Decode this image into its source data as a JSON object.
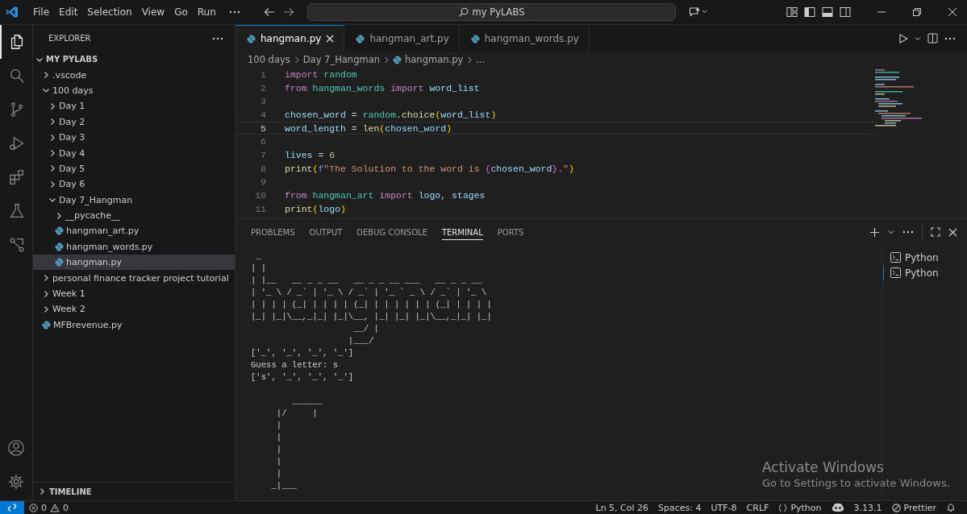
{
  "window": {
    "search": "my PyLABS"
  },
  "menu": [
    "File",
    "Edit",
    "Selection",
    "View",
    "Go",
    "Run"
  ],
  "activity_bar": [
    {
      "selected": true
    },
    {
      "selected": false
    },
    {
      "selected": false
    },
    {
      "selected": false
    },
    {
      "selected": false
    },
    {
      "selected": false
    },
    {
      "selected": false
    }
  ],
  "explorer": {
    "title": "EXPLORER",
    "root": {
      "label": "MY PYLABS",
      "kind": "folder",
      "expanded": true,
      "selected": false,
      "children": [
        {
          "label": ".vscode",
          "kind": "folder",
          "expanded": false,
          "selected": false
        },
        {
          "label": "100 days",
          "kind": "folder",
          "expanded": true,
          "selected": false,
          "children": [
            {
              "label": "Day 1",
              "kind": "folder",
              "expanded": false,
              "selected": false
            },
            {
              "label": "Day 2",
              "kind": "folder",
              "expanded": false,
              "selected": false
            },
            {
              "label": "Day 3",
              "kind": "folder",
              "expanded": false,
              "selected": false
            },
            {
              "label": "Day 4",
              "kind": "folder",
              "expanded": false,
              "selected": false
            },
            {
              "label": "Day 5",
              "kind": "folder",
              "expanded": false,
              "selected": false
            },
            {
              "label": "Day 6",
              "kind": "folder",
              "expanded": false,
              "selected": false
            },
            {
              "label": "Day 7_Hangman",
              "kind": "folder",
              "expanded": true,
              "selected": false,
              "children": [
                {
                  "label": "__pycache__",
                  "kind": "folder",
                  "expanded": false,
                  "selected": false
                },
                {
                  "label": "hangman_art.py",
                  "kind": "file",
                  "selected": false
                },
                {
                  "label": "hangman_words.py",
                  "kind": "file",
                  "selected": false
                },
                {
                  "label": "hangman.py",
                  "kind": "file",
                  "selected": true
                }
              ]
            }
          ]
        },
        {
          "label": "personal finance tracker project tutorial",
          "kind": "folder",
          "expanded": false,
          "selected": false
        },
        {
          "label": "Week 1",
          "kind": "folder",
          "expanded": false,
          "selected": false
        },
        {
          "label": "Week 2",
          "kind": "folder",
          "expanded": false,
          "selected": false
        },
        {
          "label": "MFBrevenue.py",
          "kind": "file",
          "selected": false
        }
      ]
    },
    "timeline": {
      "label": "TIMELINE",
      "expanded": false
    }
  },
  "editor": {
    "tabs": [
      {
        "label": "hangman.py",
        "selected": true
      },
      {
        "label": "hangman_art.py",
        "selected": false
      },
      {
        "label": "hangman_words.py",
        "selected": false
      }
    ],
    "breadcrumb": [
      {
        "label": "100 days",
        "kind": "folder"
      },
      {
        "label": "Day 7_Hangman",
        "kind": "folder"
      },
      {
        "label": "hangman.py",
        "kind": "file"
      },
      {
        "label": "...",
        "kind": "more"
      }
    ],
    "lines": [
      {
        "number": "1",
        "current": false,
        "tokens": [
          {
            "text": "import",
            "kind": "keyword"
          },
          {
            "text": " random",
            "kind": "module"
          }
        ]
      },
      {
        "number": "2",
        "current": false,
        "tokens": [
          {
            "text": "from",
            "kind": "keyword"
          },
          {
            "text": " hangman_words",
            "kind": "module"
          },
          {
            "text": " import",
            "kind": "keyword"
          },
          {
            "text": " word_list",
            "kind": "variable"
          }
        ]
      },
      {
        "number": "3",
        "current": false
      },
      {
        "number": "4",
        "current": false,
        "tokens": [
          {
            "text": "chosen_word",
            "kind": "variable"
          },
          {
            "text": " = ",
            "kind": "plain"
          },
          {
            "text": "random",
            "kind": "module"
          },
          {
            "text": ".",
            "kind": "plain"
          },
          {
            "text": "choice",
            "kind": "function"
          },
          {
            "text": "(",
            "kind": "bracket"
          },
          {
            "text": "word_list",
            "kind": "variable"
          },
          {
            "text": ")",
            "kind": "bracket"
          }
        ]
      },
      {
        "number": "5",
        "current": true,
        "tokens": [
          {
            "text": "word_length",
            "kind": "variable"
          },
          {
            "text": " = ",
            "kind": "plain"
          },
          {
            "text": "len",
            "kind": "function"
          },
          {
            "text": "(",
            "kind": "bracket"
          },
          {
            "text": "chosen_word",
            "kind": "variable"
          },
          {
            "text": ")",
            "kind": "bracket"
          }
        ]
      },
      {
        "number": "6",
        "current": false
      },
      {
        "number": "7",
        "current": false,
        "tokens": [
          {
            "text": "lives",
            "kind": "variable"
          },
          {
            "text": " = ",
            "kind": "plain"
          },
          {
            "text": "6",
            "kind": "number"
          }
        ]
      },
      {
        "number": "8",
        "current": false,
        "tokens": [
          {
            "text": "print",
            "kind": "function"
          },
          {
            "text": "(",
            "kind": "bracket"
          },
          {
            "text": "f",
            "kind": "prefix"
          },
          {
            "text": "\"The Solution to the word is ",
            "kind": "string"
          },
          {
            "text": "{",
            "kind": "bracket2"
          },
          {
            "text": "chosen_word",
            "kind": "variable"
          },
          {
            "text": "}",
            "kind": "bracket2"
          },
          {
            "text": ".\"",
            "kind": "string"
          },
          {
            "text": ")",
            "kind": "bracket"
          }
        ]
      },
      {
        "number": "9",
        "current": false
      },
      {
        "number": "10",
        "current": false,
        "tokens": [
          {
            "text": "from",
            "kind": "keyword"
          },
          {
            "text": " hangman_art",
            "kind": "module"
          },
          {
            "text": " import",
            "kind": "keyword"
          },
          {
            "text": " logo",
            "kind": "variable"
          },
          {
            "text": ", ",
            "kind": "plain"
          },
          {
            "text": "stages",
            "kind": "variable"
          }
        ]
      },
      {
        "number": "11",
        "current": false,
        "tokens": [
          {
            "text": "print",
            "kind": "function"
          },
          {
            "text": "(",
            "kind": "bracket"
          },
          {
            "text": "logo",
            "kind": "variable"
          },
          {
            "text": ")",
            "kind": "bracket"
          }
        ]
      }
    ]
  },
  "panel": {
    "tabs": [
      {
        "label": "PROBLEMS",
        "selected": false
      },
      {
        "label": "OUTPUT",
        "selected": false
      },
      {
        "label": "DEBUG CONSOLE",
        "selected": false
      },
      {
        "label": "TERMINAL",
        "selected": true
      },
      {
        "label": "PORTS",
        "selected": false
      }
    ],
    "terminal": {
      "output": [
        " _",
        "| |",
        "| |__   __ _ _ __   __ _ _ __ ___   __ _ _ __",
        "| '_ \\ / _` | '_ \\ / _` | '_ ` _ \\ / _` | '_ \\",
        "| | | | (_| | | | | (_| | | | | | | (_| | | | |",
        "|_| |_|\\__,_|_| |_|\\__, |_| |_| |_|\\__,_|_| |_|",
        "                    __/ |",
        "                   |___/",
        "['_', '_', '_', '_']",
        "Guess a letter: s",
        "['s', '_', '_', '_']"
      ],
      "stage": [
        "        ______",
        "     |/     |",
        "     |",
        "     |",
        "     |",
        "     |",
        "     |",
        "    _|___"
      ],
      "sessions": [
        {
          "label": "Python",
          "selected": false
        },
        {
          "label": "Python",
          "selected": true
        }
      ]
    }
  },
  "status_bar": {
    "errors": "0",
    "warnings": "0",
    "items": [
      {
        "text": "Ln 5, Col 26",
        "kind": "text"
      },
      {
        "text": "Spaces: 4",
        "kind": "text"
      },
      {
        "text": "UTF-8",
        "kind": "text"
      },
      {
        "text": "CRLF",
        "kind": "text"
      },
      {
        "text": "Python",
        "kind": "language"
      },
      {
        "kind": "copilot"
      },
      {
        "text": "3.13.1",
        "kind": "text"
      },
      {
        "text": "Prettier",
        "kind": "prettier"
      },
      {
        "kind": "bell"
      }
    ]
  },
  "os_overlay": {
    "title": "Activate Windows",
    "subtitle": "Go to Settings to activate Windows."
  }
}
